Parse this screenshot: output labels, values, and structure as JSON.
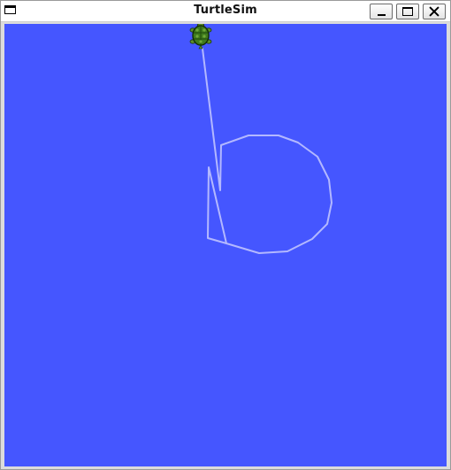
{
  "window": {
    "title": "TurtleSim"
  },
  "controls": {
    "minimize_icon": "minimize-icon",
    "maximize_icon": "maximize-icon",
    "close_icon": "close-icon"
  },
  "canvas": {
    "background_color": "#4556ff",
    "pen_color": "#b3b8ff"
  },
  "turtle": {
    "icon": "turtle-icon",
    "shell_color": "#3f7b1c"
  }
}
